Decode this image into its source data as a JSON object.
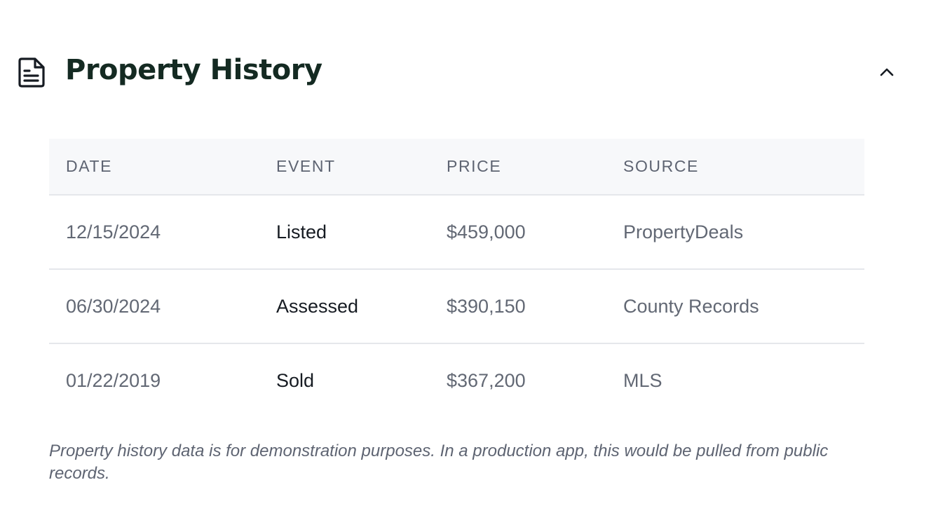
{
  "section": {
    "title": "Property History",
    "icon": "document-icon",
    "toggle_icon": "chevron-up-icon"
  },
  "table": {
    "columns": [
      "DATE",
      "EVENT",
      "PRICE",
      "SOURCE"
    ],
    "rows": [
      {
        "date": "12/15/2024",
        "event": "Listed",
        "price": "$459,000",
        "source": "PropertyDeals"
      },
      {
        "date": "06/30/2024",
        "event": "Assessed",
        "price": "$390,150",
        "source": "County Records"
      },
      {
        "date": "01/22/2019",
        "event": "Sold",
        "price": "$367,200",
        "source": "MLS"
      }
    ]
  },
  "footnote": "Property history data is for demonstration purposes. In a production app, this would be pulled from public records.",
  "colors": {
    "title": "#142a22",
    "header_bg": "#f7f8fa",
    "muted_text": "#626874",
    "divider": "#e5e7eb"
  }
}
